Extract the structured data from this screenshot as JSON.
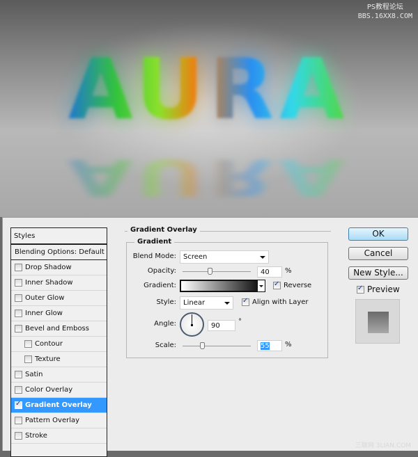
{
  "artwork": {
    "word": "AURA",
    "watermark_line1": "PS教程论坛",
    "watermark_line2": "BBS.16XX8.COM",
    "watermark_bottom": "三联网 3LIAN.COM"
  },
  "styles_panel": {
    "header": "Styles",
    "blending_options": "Blending Options: Default",
    "items": [
      {
        "label": "Drop Shadow",
        "checked": false,
        "sub": false
      },
      {
        "label": "Inner Shadow",
        "checked": false,
        "sub": false
      },
      {
        "label": "Outer Glow",
        "checked": false,
        "sub": false
      },
      {
        "label": "Inner Glow",
        "checked": false,
        "sub": false
      },
      {
        "label": "Bevel and Emboss",
        "checked": false,
        "sub": false
      },
      {
        "label": "Contour",
        "checked": false,
        "sub": true
      },
      {
        "label": "Texture",
        "checked": false,
        "sub": true
      },
      {
        "label": "Satin",
        "checked": false,
        "sub": false
      },
      {
        "label": "Color Overlay",
        "checked": false,
        "sub": false
      },
      {
        "label": "Gradient Overlay",
        "checked": true,
        "sub": false,
        "selected": true
      },
      {
        "label": "Pattern Overlay",
        "checked": false,
        "sub": false
      },
      {
        "label": "Stroke",
        "checked": false,
        "sub": false
      }
    ]
  },
  "panel": {
    "title": "Gradient Overlay",
    "group": "Gradient",
    "blend_mode_label": "Blend Mode:",
    "blend_mode": "Screen",
    "opacity_label": "Opacity:",
    "opacity": "40",
    "opacity_unit": "%",
    "gradient_label": "Gradient:",
    "reverse_label": "Reverse",
    "reverse": true,
    "style_label": "Style:",
    "style": "Linear",
    "align_label": "Align with Layer",
    "align": true,
    "angle_label": "Angle:",
    "angle": "90",
    "angle_unit": "°",
    "scale_label": "Scale:",
    "scale": "55",
    "scale_unit": "%"
  },
  "buttons": {
    "ok": "OK",
    "cancel": "Cancel",
    "new_style": "New Style...",
    "preview_label": "Preview",
    "preview": true
  },
  "colors": {
    "selection": "#3399ff",
    "dialog_bg": "#ececec",
    "default_button": "#a9dbf6"
  }
}
